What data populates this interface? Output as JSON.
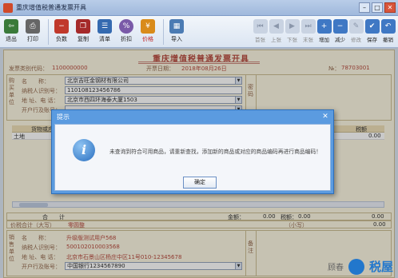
{
  "window": {
    "title": "重庆增值税普通发票开具"
  },
  "toolbar": {
    "left": [
      {
        "label": "退出",
        "icon": "exit-icon",
        "color": "#3a7a3a"
      },
      {
        "label": "打印",
        "icon": "print-icon",
        "color": "#555"
      },
      {
        "label": "负数",
        "icon": "negative-icon",
        "color": "#c0392b"
      },
      {
        "label": "复制",
        "icon": "copy-icon",
        "color": "#a52a2a"
      },
      {
        "label": "清单",
        "icon": "list-icon",
        "color": "#356ab0"
      },
      {
        "label": "折扣",
        "icon": "discount-icon",
        "color": "#7a5aa8",
        "badge": "%"
      },
      {
        "label": "价格",
        "icon": "price-icon",
        "color": "#d98b1a",
        "red": true
      },
      {
        "label": "导入",
        "icon": "import-icon",
        "color": "#4b7bb3"
      }
    ],
    "right": [
      {
        "label": "首张",
        "active": false
      },
      {
        "label": "上张",
        "active": false
      },
      {
        "label": "下张",
        "active": false
      },
      {
        "label": "末张",
        "active": false
      },
      {
        "label": "增加",
        "active": true
      },
      {
        "label": "减少",
        "active": true
      },
      {
        "label": "修改",
        "active": false
      },
      {
        "label": "保存",
        "active": true
      },
      {
        "label": "撤销",
        "active": true
      }
    ]
  },
  "invoice": {
    "title": "重庆增值税普通发票开具",
    "code_label": "发票类别代码：",
    "code_value": "1100000000",
    "date_label": "开票日期：",
    "date_value": "2018年08月26日",
    "no_label": "№：",
    "no_value": "78703001",
    "buyer_side_label": "购买单位",
    "buyer": {
      "name_label": "名　　称：",
      "name_value": "北京吉旺金钢材有限公司",
      "tax_label": "纳税人识别号：",
      "tax_value": "110108123456786",
      "addr_label": "地 址、电 话：",
      "addr_value": "北京市西四环海泰大厦1503",
      "bank_label": "开户行及账号："
    },
    "password_label": "密码",
    "grid_header": {
      "name": "货物或应",
      "tax": "税额"
    },
    "grid_row": {
      "name": "土地",
      "tax": "0.00"
    },
    "total_label": "合　　计",
    "total_amount_label": "金额：",
    "total_amount": "0.00",
    "total_tax_label": "税额：",
    "total_tax": "0.00",
    "total_tax_value": "0.00",
    "price_tax_label": "价税合计（大写）",
    "price_tax_value": "零圆整",
    "lower_label": "（小写）",
    "lower_value": "0.00",
    "seller_side_label": "销售单位",
    "seller": {
      "name_label": "名　　称：",
      "name_value": "升级版测试用户568",
      "tax_label": "纳税人识别号：",
      "tax_value": "500102010003568",
      "addr_label": "地 址、电 话：",
      "addr_value": "北京市石景山区杨庄中区11号010-12345678",
      "bank_label": "开户行及账号：",
      "bank_value": "中国银行1234567890"
    },
    "remark_label": "备注"
  },
  "dialog": {
    "title": "提示",
    "message": "未查询到符合可用商品，请重新查找，添加新的商品或对应的商品编码再进行商品编码！",
    "ok_label": "确定"
  },
  "watermark": {
    "text": "顾春",
    "brand": "税屋"
  }
}
